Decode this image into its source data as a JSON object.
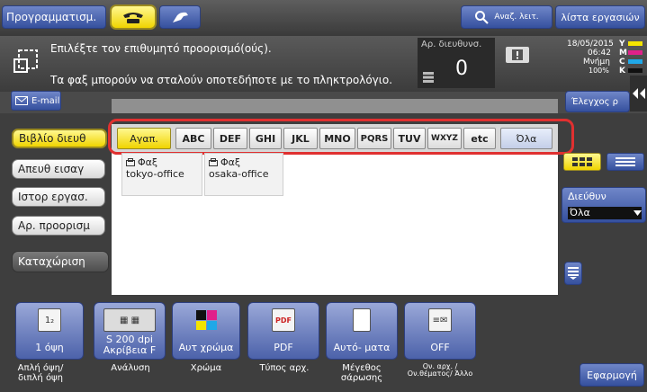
{
  "topbar": {
    "programs_label": "Προγραμματισμ.",
    "search_label": "Αναζ. λειτ.",
    "jobs_label": "λίστα εργασιών"
  },
  "message": {
    "line1": "Επιλέξτε τον επιθυμητό προορισμό(ούς).",
    "line2": "Τα φαξ μπορούν να σταλούν οποτεδήποτε με το πληκτρολόγιο.",
    "dest_count_label": "Αρ. διευθυνσ.",
    "dest_count": "0",
    "date": "18/05/2015",
    "time": "06:42",
    "memory_label": "Μνήμη",
    "memory_value": "100%",
    "toner": [
      "Y",
      "M",
      "C",
      "K"
    ]
  },
  "email_tab": "E-mail",
  "check_label": "Έλεγχος ρ",
  "sidebar": [
    {
      "label": "Βιβλίο διευθ"
    },
    {
      "label": "Απευθ εισαγ"
    },
    {
      "label": "Ιστορ εργασ."
    },
    {
      "label": "Αρ. προορισμ"
    },
    {
      "label": "Καταχώριση"
    }
  ],
  "alpha_tabs": [
    "Αγαπ.",
    "ABC",
    "DEF",
    "GHI",
    "JKL",
    "MNO",
    "PQRS",
    "TUV",
    "WXYZ",
    "etc",
    "Όλα"
  ],
  "address_cards": [
    {
      "type": "Φαξ",
      "name": "tokyo-office"
    },
    {
      "type": "Φαξ",
      "name": "osaka-office"
    }
  ],
  "address_filter": {
    "label": "Διεύθυν",
    "value": "Όλα"
  },
  "tools": [
    {
      "value": "1 όψη",
      "label": "Απλή όψη/ διπλή όψη"
    },
    {
      "value": "S 200 dpi Ακρίβεια F",
      "label": "Ανάλυση"
    },
    {
      "value": "Αυτ χρώμα",
      "label": "Χρώμα"
    },
    {
      "value": "PDF",
      "label": "Τύπος αρχ."
    },
    {
      "value": "Αυτό- ματα",
      "label": "Μέγεθος σάρωσης"
    },
    {
      "value": "OFF",
      "label": "Ον. αρχ. / Ον.θέματος/ Άλλο"
    }
  ],
  "apply_label": "Εφαρμογή",
  "colors": {
    "accent_red": "#e03030",
    "selected_yellow": "#f0d400",
    "button_blue": "#35509e"
  }
}
